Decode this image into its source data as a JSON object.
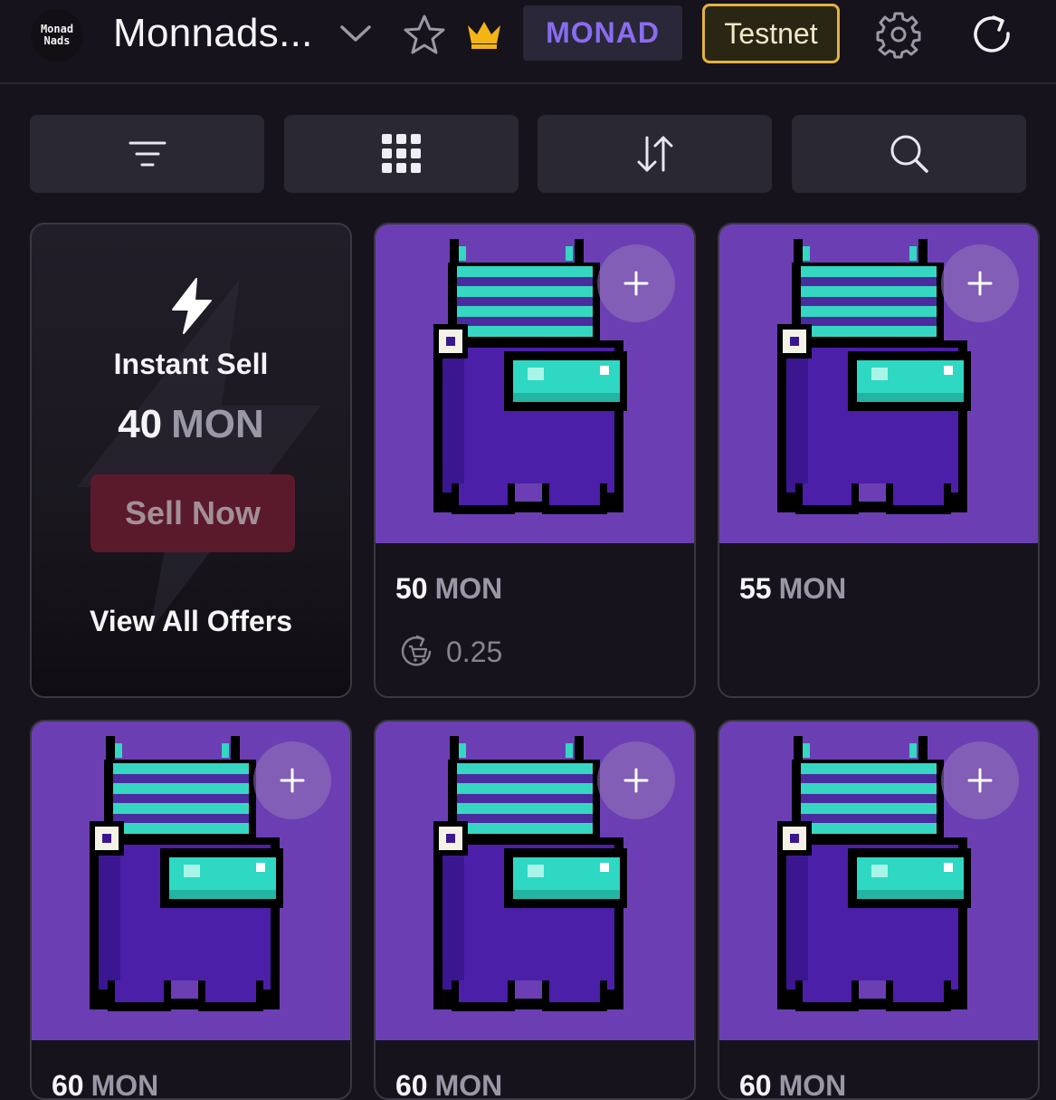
{
  "header": {
    "logo_line1": "Monad",
    "logo_line2": "Nads",
    "collection_name": "Monnads...",
    "chain_label": "MONAD",
    "network_label": "Testnet",
    "icons": [
      "chevron-down-icon",
      "star-icon",
      "crown-icon",
      "gear-icon",
      "refresh-icon"
    ],
    "accent_color": "#8a6cf0",
    "network_border_color": "#e3b341"
  },
  "toolbar": {
    "buttons": [
      "filter-icon",
      "grid-icon",
      "sort-icon",
      "search-icon"
    ]
  },
  "instant_sell": {
    "title": "Instant Sell",
    "amount": "40",
    "unit": "MON",
    "sell_button": "Sell Now",
    "view_offers": "View All Offers"
  },
  "items": [
    {
      "price": "50",
      "unit": "MON",
      "royalty": "0.25"
    },
    {
      "price": "55",
      "unit": "MON"
    },
    {
      "price": "60",
      "unit": "MON"
    },
    {
      "price": "60",
      "unit": "MON"
    },
    {
      "price": "60",
      "unit": "MON"
    }
  ],
  "card_bg_color": "#6b3fb3"
}
